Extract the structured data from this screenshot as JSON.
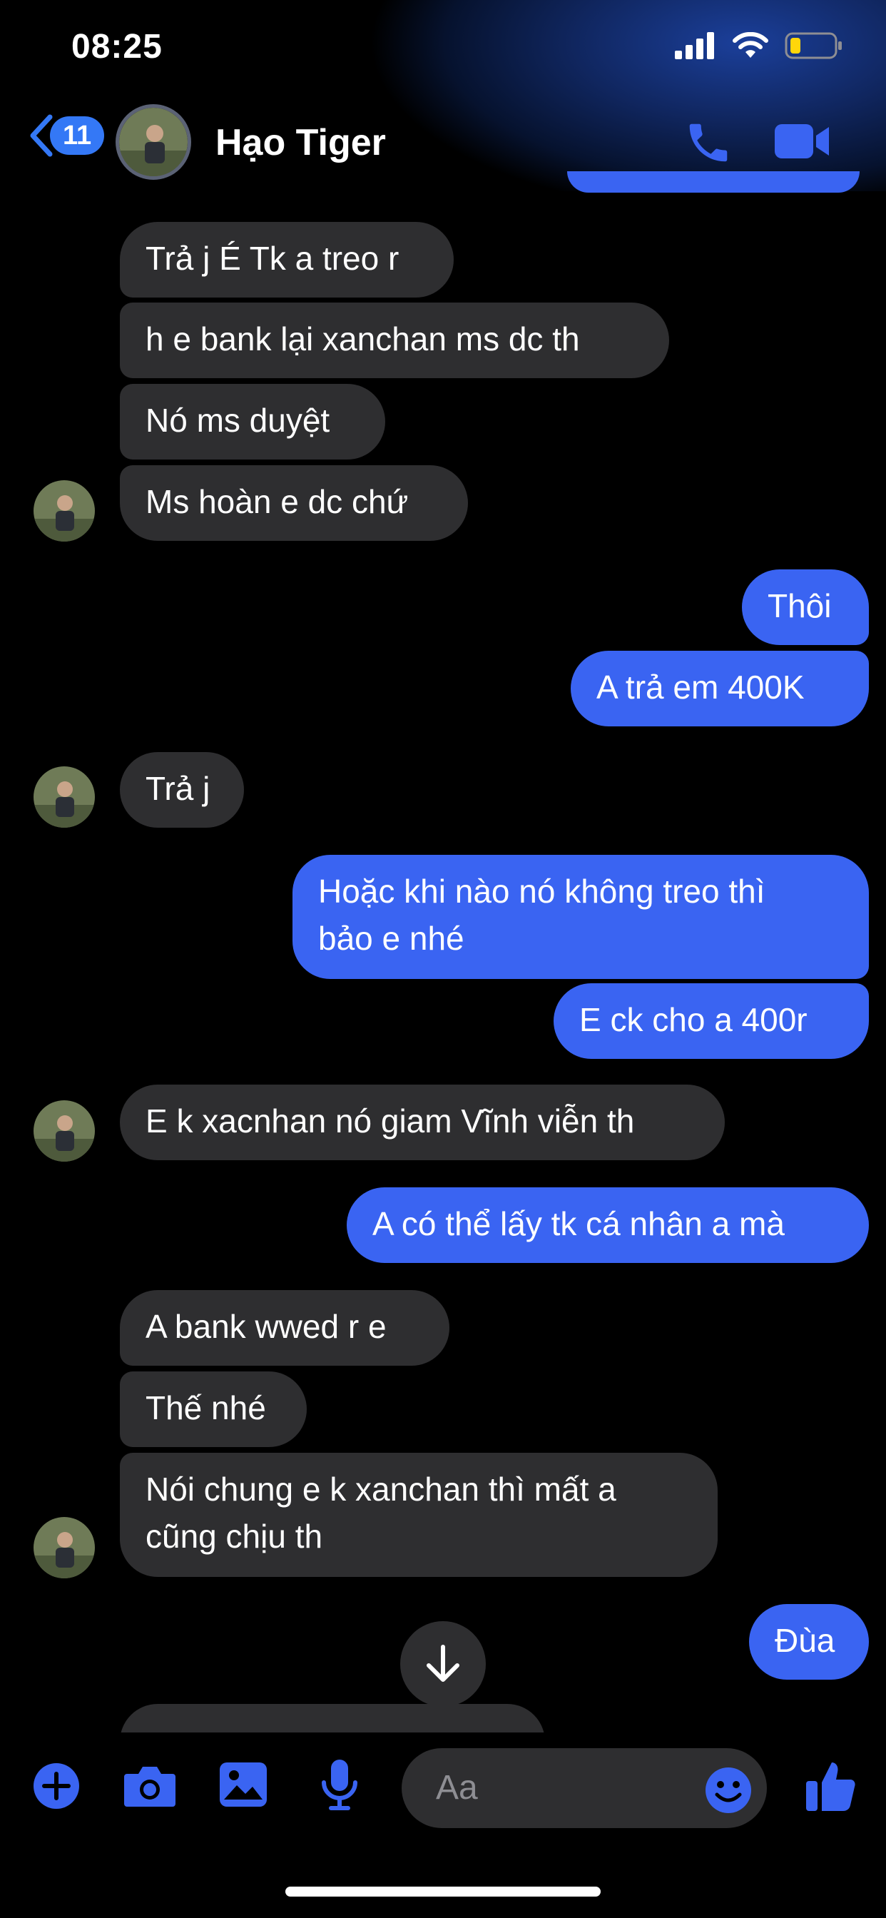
{
  "status_bar": {
    "time": "08:25"
  },
  "header": {
    "back_badge": "11",
    "contact_name": "Hạo Tiger"
  },
  "messages": [
    {
      "dir": "in",
      "text": "Trả j É Tk a treo r"
    },
    {
      "dir": "in",
      "text": "h e bank lại xanchan ms dc th"
    },
    {
      "dir": "in",
      "text": "Nó ms duyệt"
    },
    {
      "dir": "in",
      "text": "Ms hoàn e dc chứ"
    },
    {
      "dir": "out",
      "text": "Thôi"
    },
    {
      "dir": "out",
      "text": "A trả em 400K"
    },
    {
      "dir": "in",
      "text": "Trả j"
    },
    {
      "dir": "out",
      "line1": "Hoặc khi nào nó không treo thì",
      "line2": "bảo e nhé"
    },
    {
      "dir": "out",
      "text": "E ck cho a 400r"
    },
    {
      "dir": "in",
      "text": "E k xacnhan nó giam Vĩnh viễn th"
    },
    {
      "dir": "out",
      "text": "A có thể lấy tk cá nhân a mà"
    },
    {
      "dir": "in",
      "text": "A bank wwed r e"
    },
    {
      "dir": "in",
      "text": "Thế nhé"
    },
    {
      "dir": "in",
      "line1": "Nói chung e k xanchan thì mất a",
      "line2": "cũng chịu th"
    },
    {
      "dir": "out",
      "text": "Đùa"
    }
  ],
  "composer": {
    "placeholder": "Aa"
  },
  "icons": {
    "add": "plus-circle-icon",
    "camera": "camera-icon",
    "gallery": "image-icon",
    "mic": "microphone-icon",
    "emoji": "emoji-icon",
    "like": "thumbs-up-icon",
    "call": "phone-icon",
    "video": "video-camera-icon",
    "scroll": "arrow-down-icon"
  },
  "colors": {
    "accent": "#3a64f2",
    "incoming_bubble": "#2e2e30",
    "background": "#000000"
  }
}
